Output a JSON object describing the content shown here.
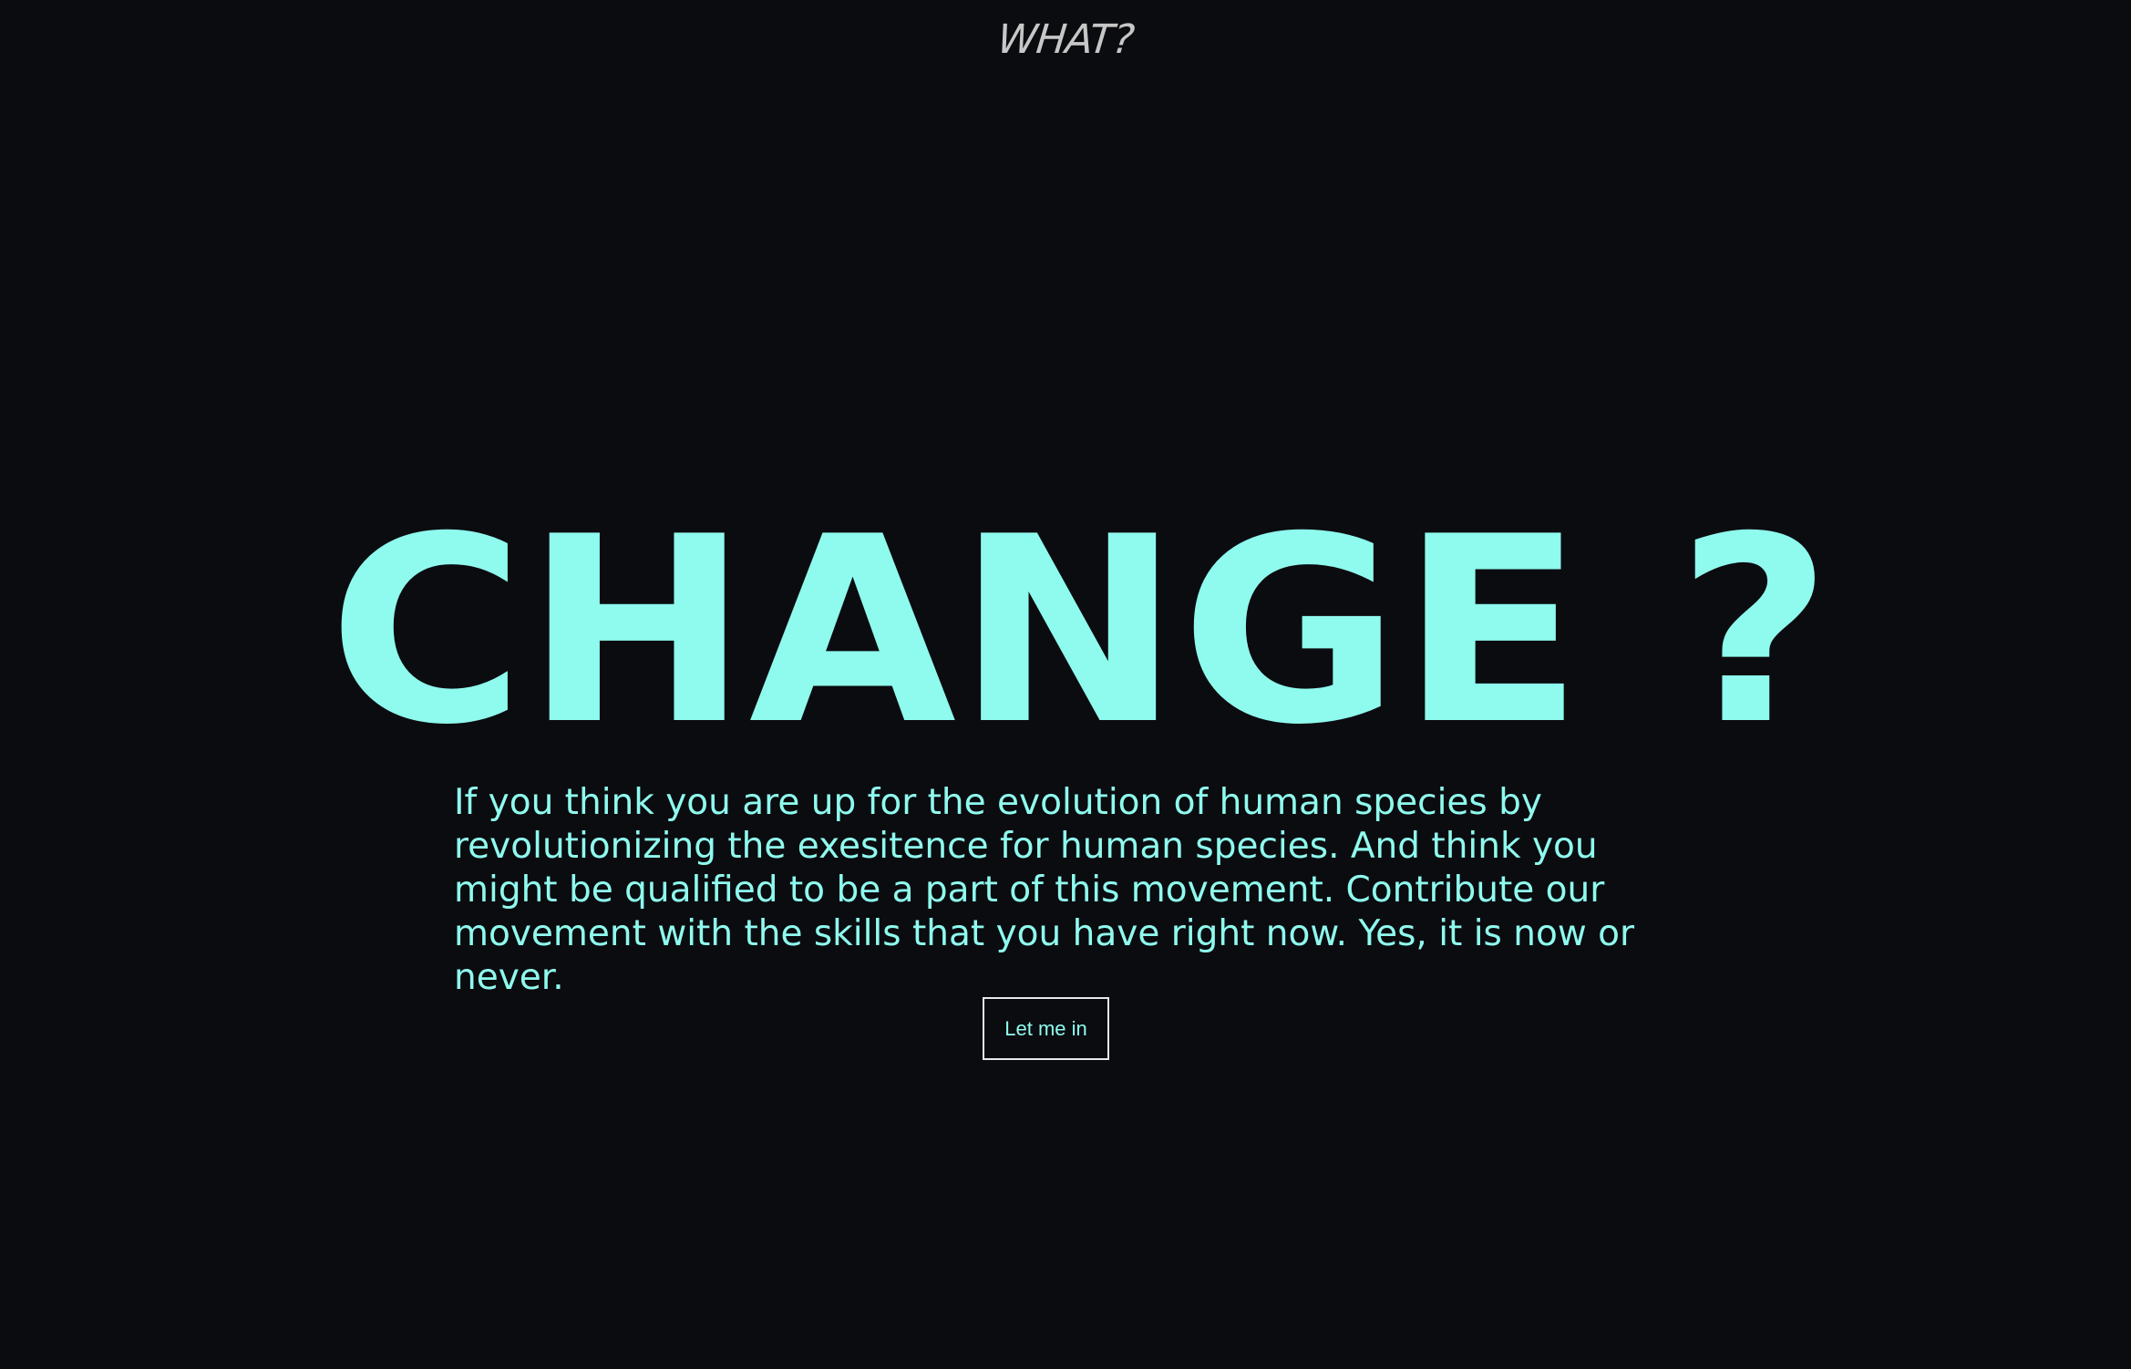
{
  "header": {
    "label": "WHAT?"
  },
  "hero": {
    "headline": "CHANGE ?",
    "description": "If you think you are up for the evolution of human species by revolutionizing the exesitence for human species. And think you might be qualified to be a part of this movement. Contribute our movement with the skills that you have right now. Yes, it is now or never.",
    "cta_label": "Let me in"
  },
  "colors": {
    "background": "#0b0c10",
    "accent": "#8ffaee",
    "muted_text": "#c7c7c7",
    "button_border": "#e9e9e9"
  }
}
